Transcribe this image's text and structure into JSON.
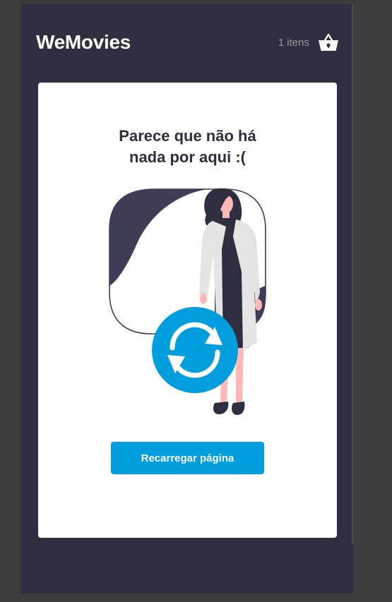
{
  "header": {
    "logo": "WeMovies",
    "cart_count_label": "1 itens",
    "cart_icon": "shopping-basket-icon"
  },
  "empty_state": {
    "title_line1": "Parece que não há",
    "title_line2": "nada por aqui :(",
    "illustration": "woman-with-reload-icon",
    "reload_icon": "refresh-icon",
    "button_label": "Recarregar página"
  },
  "colors": {
    "app_background": "#2f2e41",
    "outer_background": "#3d3d3d",
    "card_background": "#ffffff",
    "accent": "#009edd",
    "text_dark": "#2f2e41",
    "muted_text": "#999999"
  }
}
